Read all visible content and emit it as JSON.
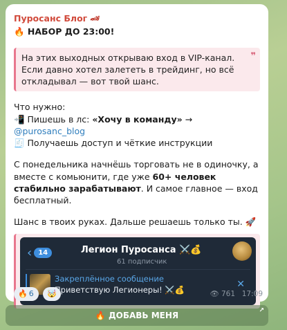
{
  "message": {
    "sender": "Пуросанс Блог",
    "headline": "🔥 НАБОР ДО 23:00!",
    "quote": "На этих выходных открываю вход в VIP-канал. Если давно хотел залететь в трейдинг, но всё откладывал — вот твой шанс.",
    "needs_title": "Что нужно:",
    "step1_prefix": "📲 Пишешь в лс: ",
    "step1_bold": "«Хочу в команду»",
    "step1_arrow": " → ",
    "step1_mention": "@purosanc_blog",
    "step2": "🧾 Получаешь доступ и чёткие инструкции",
    "para2_a": "С понедельника начнёшь торговать не в одиночку, а вместе с комьюнити, где уже ",
    "para2_bold": "60+ человек стабильно зарабатывают",
    "para2_b": ". И самое главное — вход бесплатный.",
    "para3": "Шанс в твоих руках. Дальше решаешь только ты. 🚀"
  },
  "preview": {
    "back_count": "14",
    "channel_title": "Легион Пуросанса ⚔️💰",
    "subscribers": "61 подписчик",
    "pinned_label": "Закреплённое сообщение",
    "pinned_text": "Приветствую Легионеры! ⚔️💰"
  },
  "reactions": [
    {
      "emoji": "🔥",
      "count": "6"
    },
    {
      "emoji": "🤯",
      "count": ""
    }
  ],
  "meta": {
    "views": "761",
    "time": "17:09"
  },
  "cta": {
    "label": "🔥 ДОБАВЬ МЕНЯ"
  }
}
